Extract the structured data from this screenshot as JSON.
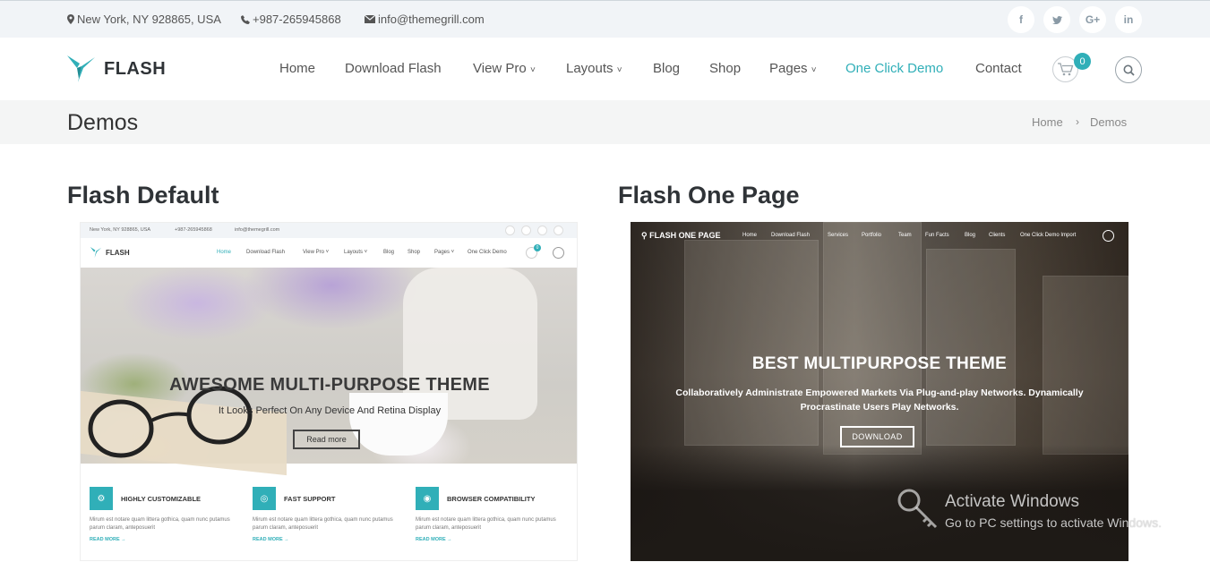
{
  "topbar": {
    "address": "New York, NY 928865, USA",
    "phone": "+987-265945868",
    "email": "info@themegrill.com",
    "social": [
      "f",
      "t",
      "G+",
      "in"
    ]
  },
  "header": {
    "logo_text": "FLASH",
    "nav": [
      "Home",
      "Download Flash",
      "View Pro",
      "Layouts",
      "Blog",
      "Shop",
      "Pages",
      "One Click Demo",
      "Contact"
    ],
    "nav_active": "One Click Demo",
    "cart_count": "0",
    "accent_color": "#30afb8"
  },
  "page": {
    "title": "Demos",
    "breadcrumb": [
      "Home",
      "Demos"
    ]
  },
  "demos": [
    {
      "title": "Flash Default",
      "preview": {
        "top_address": "New York, NY 928865, USA",
        "top_phone": "+987-265945868",
        "top_email": "info@themegrill.com",
        "logo": "FLASH",
        "nav": [
          "Home",
          "Download Flash",
          "View Pro ˅",
          "Layouts ˅",
          "Blog",
          "Shop",
          "Pages ˅",
          "One Click Demo"
        ],
        "cart_count": "0",
        "hero_title": "AWESOME MULTI-PURPOSE THEME",
        "hero_subtitle": "It Looks Perfect On Any Device And Retina Display",
        "hero_button": "Read more",
        "features": [
          {
            "title": "HIGHLY CUSTOMIZABLE",
            "text": "Mirum est notare quam littera gothica, quam nunc putamus parum claram, anteposuerit",
            "more": "READ MORE →"
          },
          {
            "title": "FAST SUPPORT",
            "text": "Mirum est notare quam littera gothica, quam nunc putamus parum claram, anteposuerit",
            "more": "READ MORE →"
          },
          {
            "title": "BROWSER COMPATIBILITY",
            "text": "Mirum est notare quam littera gothica, quam nunc putamus parum claram, anteposuerit",
            "more": "READ MORE →"
          }
        ]
      }
    },
    {
      "title": "Flash One Page",
      "preview": {
        "logo": "FLASH ONE PAGE",
        "nav": [
          "Home",
          "Download Flash",
          "Services",
          "Portfolio",
          "Team",
          "Fun Facts",
          "Blog",
          "Clients",
          "One Click Demo Import"
        ],
        "hero_title": "BEST MULTIPURPOSE THEME",
        "hero_subtitle": "Collaboratively Administrate Empowered Markets Via Plug-and-play Networks. Dynamically Procrastinate Users Play Networks.",
        "hero_button": "DOWNLOAD"
      }
    }
  ],
  "watermark": {
    "title": "Activate Windows",
    "subtitle": "Go to PC settings to activate Windows."
  }
}
